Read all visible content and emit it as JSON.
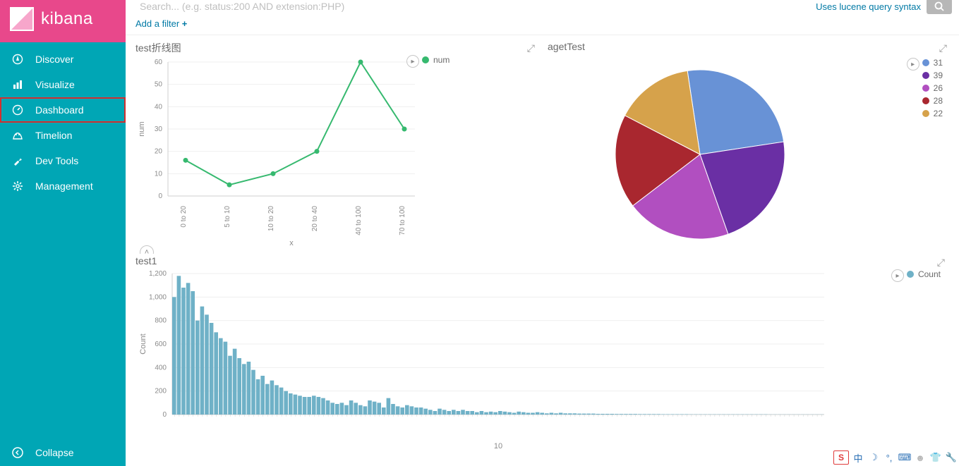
{
  "brand": {
    "name": "kibana"
  },
  "sidebar": {
    "items": [
      {
        "label": "Discover",
        "icon": "compass-icon"
      },
      {
        "label": "Visualize",
        "icon": "barchart-icon"
      },
      {
        "label": "Dashboard",
        "icon": "dashboard-icon",
        "active": true
      },
      {
        "label": "Timelion",
        "icon": "timelion-icon"
      },
      {
        "label": "Dev Tools",
        "icon": "wrench-icon"
      },
      {
        "label": "Management",
        "icon": "gear-icon"
      }
    ],
    "collapse_label": "Collapse"
  },
  "topbar": {
    "search_placeholder": "Search... (e.g. status:200 AND extension:PHP)",
    "lucene_link": "Uses lucene query syntax",
    "filter_label": "Add a filter",
    "filter_plus": "+"
  },
  "panels": {
    "line": {
      "title": "test折线图",
      "legend": [
        "num"
      ]
    },
    "pie": {
      "title": "agetTest",
      "legend": [
        "31",
        "39",
        "26",
        "28",
        "22"
      ]
    },
    "hist": {
      "title": "test1",
      "legend": [
        "Count"
      ],
      "xlabel": "10"
    }
  },
  "colors": {
    "line_series": "#36b96f",
    "pie": [
      "#6892d6",
      "#6a2fa4",
      "#b14fc0",
      "#a9272f",
      "#d6a24b"
    ],
    "hist": "#6fb1c7"
  },
  "chart_data": [
    {
      "id": "line",
      "type": "line",
      "title": "test折线图",
      "xlabel": "x",
      "ylabel": "num",
      "ylim": [
        0,
        60
      ],
      "categories": [
        "0 to 20",
        "5 to 10",
        "10 to 20",
        "20 to 40",
        "40 to 100",
        "70 to 100"
      ],
      "series": [
        {
          "name": "num",
          "values": [
            16,
            5,
            10,
            20,
            60,
            30
          ]
        }
      ]
    },
    {
      "id": "pie",
      "type": "pie",
      "title": "agetTest",
      "categories": [
        "31",
        "39",
        "26",
        "28",
        "22"
      ],
      "values": [
        25,
        22,
        20,
        18,
        15
      ]
    },
    {
      "id": "hist",
      "type": "bar",
      "title": "test1",
      "xlabel": "10",
      "ylabel": "Count",
      "ylim": [
        0,
        1200
      ],
      "series": [
        {
          "name": "Count",
          "values": [
            1000,
            1180,
            1080,
            1120,
            1050,
            800,
            920,
            850,
            780,
            700,
            650,
            620,
            500,
            560,
            480,
            430,
            450,
            380,
            300,
            330,
            260,
            290,
            250,
            230,
            200,
            180,
            170,
            160,
            150,
            150,
            160,
            150,
            140,
            120,
            100,
            90,
            100,
            80,
            120,
            100,
            80,
            70,
            120,
            110,
            100,
            60,
            140,
            90,
            70,
            60,
            80,
            70,
            60,
            60,
            50,
            40,
            30,
            50,
            40,
            30,
            40,
            30,
            40,
            30,
            30,
            20,
            30,
            20,
            25,
            20,
            30,
            25,
            20,
            15,
            25,
            20,
            15,
            15,
            20,
            15,
            10,
            15,
            10,
            15,
            10,
            10,
            10,
            8,
            8,
            8,
            8,
            6,
            6,
            6,
            6,
            5,
            5,
            5,
            5,
            5,
            4,
            4,
            4,
            4,
            4,
            3,
            3,
            3,
            3,
            3,
            3,
            2,
            2,
            2,
            2,
            2,
            2,
            2,
            2,
            2,
            2,
            2,
            2,
            2,
            2,
            2,
            2,
            2,
            1,
            1,
            1,
            1,
            1,
            1,
            1,
            1,
            1,
            1,
            1,
            1
          ]
        }
      ]
    }
  ]
}
